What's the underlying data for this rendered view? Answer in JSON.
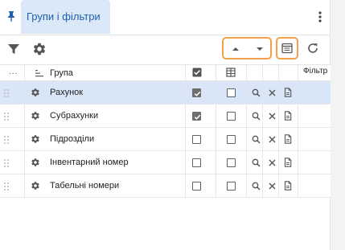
{
  "header": {
    "tab_label": "Групи і фільтри",
    "pin_icon": "pin-icon",
    "menu_icon": "more-vert-icon"
  },
  "toolbar": {
    "filter_icon": "filter-icon",
    "settings_icon": "gear-icon",
    "sort_up_icon": "triangle-up-icon",
    "sort_down_icon": "triangle-down-icon",
    "table_settings_icon": "table-icon",
    "refresh_icon": "refresh-icon",
    "highlight_color": "#f4a04a"
  },
  "table": {
    "columns": {
      "handle": "...",
      "group": "Група",
      "filter": "Фільтр"
    },
    "rows": [
      {
        "name": "Рахунок",
        "show": true,
        "column": false,
        "selected": true
      },
      {
        "name": "Субрахунки",
        "show": true,
        "column": false,
        "selected": false
      },
      {
        "name": "Підрозділи",
        "show": false,
        "column": false,
        "selected": false
      },
      {
        "name": "Інвентарний номер",
        "show": false,
        "column": false,
        "selected": false
      },
      {
        "name": "Табельні номери",
        "show": false,
        "column": false,
        "selected": false
      }
    ]
  },
  "colors": {
    "accent": "#1f5fae",
    "tab_bg": "#dbe8f8",
    "selected_row": "#d9e6f7"
  }
}
